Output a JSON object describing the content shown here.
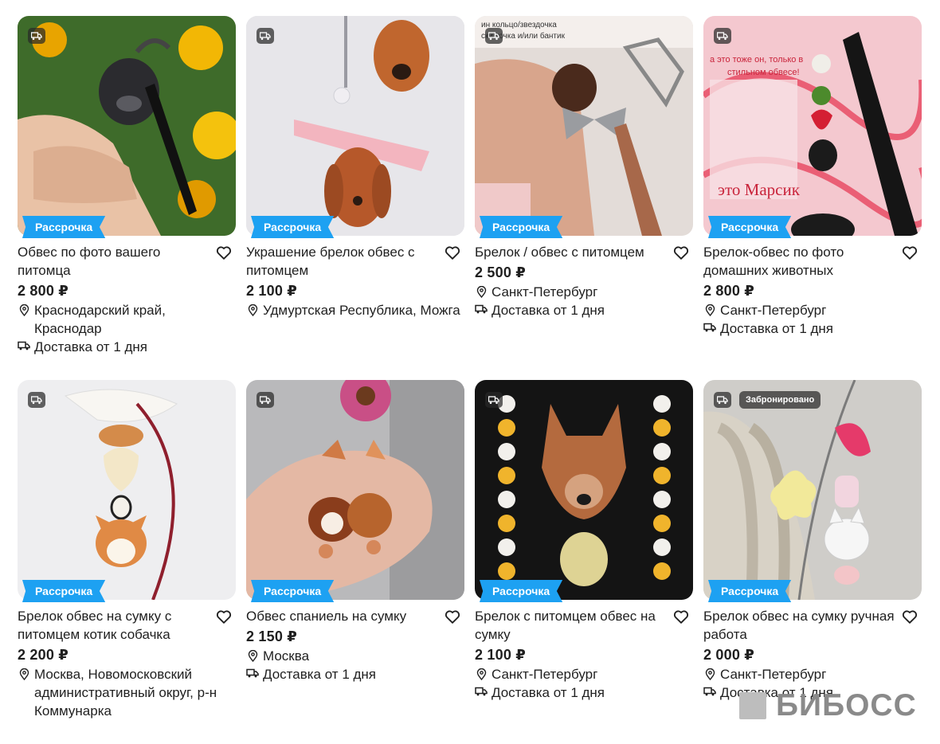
{
  "badges": {
    "installment": "Рассрочка",
    "reserved": "Забронировано"
  },
  "watermark": "БИБОСС",
  "colors": {
    "installment_badge": "#1da1f2",
    "price_text": "#1f1f1f"
  },
  "listings": [
    {
      "title": "Обвес по фото вашего питомца",
      "price": "2 800 ₽",
      "location": "Краснодарский край, Краснодар",
      "delivery": "Доставка от 1 дня",
      "installment": true,
      "reserved": false
    },
    {
      "title": "Украшение брелок обвес с питомцем",
      "price": "2 100 ₽",
      "location": "Удмуртская Республика, Можга",
      "delivery": "",
      "installment": true,
      "reserved": false
    },
    {
      "title": "Брелок / обвес с питомцем",
      "price": "2 500 ₽",
      "location": "Санкт-Петербург",
      "delivery": "Доставка от 1 дня",
      "installment": true,
      "reserved": false,
      "photo_text": [
        "ин кольцо/звездочка",
        "ски точка и/или бантик"
      ]
    },
    {
      "title": "Брелок-обвес по фото домашних животных",
      "price": "2 800 ₽",
      "location": "Санкт-Петербург",
      "delivery": "Доставка от 1 дня",
      "installment": true,
      "reserved": false,
      "photo_text": [
        "а это тоже он, только в",
        "стильном обвесе!",
        "это Марсик"
      ]
    },
    {
      "title": "Брелок обвес на сумку с питомцем котик собачка",
      "price": "2 200 ₽",
      "location": "Москва, Новомосковский административный округ, р-н Коммунарка",
      "delivery": "",
      "installment": true,
      "reserved": false
    },
    {
      "title": "Обвес спаниель на сумку",
      "price": "2 150 ₽",
      "location": "Москва",
      "delivery": "Доставка от 1 дня",
      "installment": true,
      "reserved": false
    },
    {
      "title": "Брелок с питомцем обвес на сумку",
      "price": "2 100 ₽",
      "location": "Санкт-Петербург",
      "delivery": "Доставка от 1 дня",
      "installment": true,
      "reserved": false
    },
    {
      "title": "Брелок обвес на сумку ручная работа",
      "price": "2 000 ₽",
      "location": "Санкт-Петербург",
      "delivery": "Доставка от 1 дня",
      "installment": true,
      "reserved": true
    }
  ]
}
